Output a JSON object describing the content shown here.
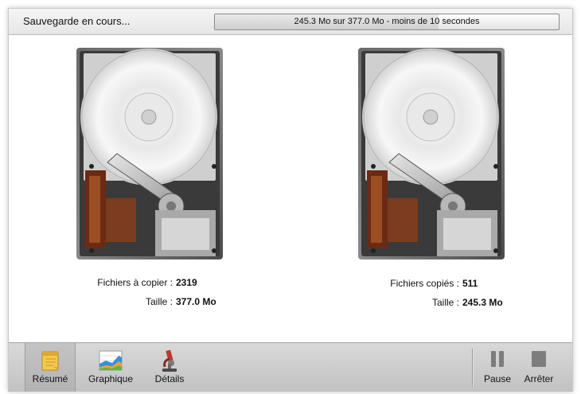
{
  "status": {
    "label": "Sauvegarde en cours...",
    "progress_text": "245.3 Mo sur 377.0 Mo - moins de 10 secondes",
    "progress_fraction": 0.65
  },
  "source": {
    "files_label": "Fichiers à copier :",
    "files_value": "2319",
    "size_label": "Taille :",
    "size_value": "377.0 Mo"
  },
  "destination": {
    "files_label": "Fichiers copiés :",
    "files_value": "511",
    "size_label": "Taille :",
    "size_value": "245.3 Mo"
  },
  "toolbar": {
    "summary_label": "Résumé",
    "graph_label": "Graphique",
    "details_label": "Détails",
    "pause_label": "Pause",
    "stop_label": "Arrêter",
    "active_tab": "summary"
  }
}
